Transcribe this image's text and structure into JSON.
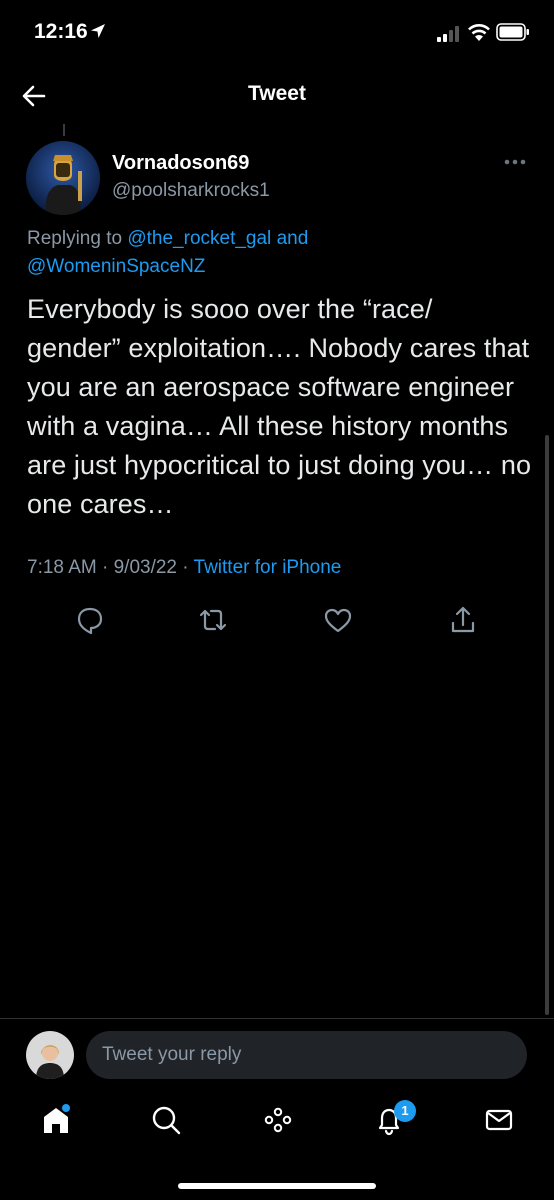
{
  "status_bar": {
    "time": "12:16",
    "icons": [
      "location-arrow-icon",
      "cellular-signal-icon",
      "wifi-icon",
      "battery-icon"
    ]
  },
  "header": {
    "title": "Tweet",
    "back_icon": "back-arrow-icon"
  },
  "tweet": {
    "display_name": "Vornadoson69",
    "handle": "@poolsharkrocks1",
    "replying_prefix": "Replying to",
    "mention_1": "@the_rocket_gal",
    "replying_join": "and",
    "mention_2": "@WomeninSpaceNZ",
    "text": "Everybody is sooo over the “race/ gender” exploitation…. Nobody cares that you are an aerospace software engineer with a vagina… All these history months are just hypocritical to just doing you… no one cares…",
    "timestamp": "7:18 AM · 9/03/22 ·",
    "source": "Twitter for iPhone",
    "actions": [
      "reply-icon",
      "retweet-icon",
      "like-icon",
      "share-icon"
    ]
  },
  "reply_bar": {
    "placeholder": "Tweet your reply"
  },
  "tabbar": {
    "items": [
      "home-icon",
      "search-icon",
      "spaces-icon",
      "notifications-icon",
      "messages-icon"
    ],
    "notification_count": "1"
  },
  "colors": {
    "background": "#000000",
    "accent": "#1d9bf0",
    "secondary_text": "#8b98a5",
    "primary_text": "#e7e9ea"
  }
}
